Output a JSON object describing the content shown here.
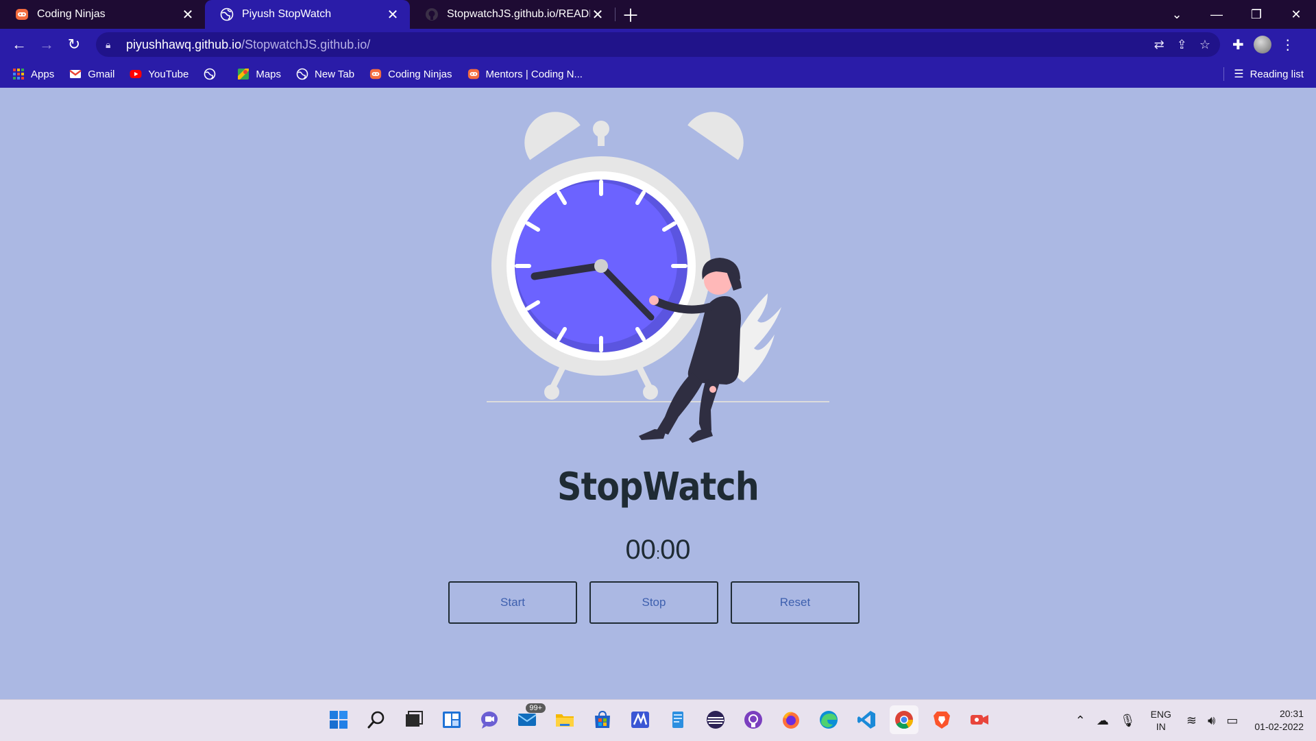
{
  "tabs": [
    {
      "title": "Coding Ninjas",
      "icon": "coding-ninjas-icon",
      "active": false
    },
    {
      "title": "Piyush StopWatch",
      "icon": "globe-icon",
      "active": true
    },
    {
      "title": "StopwatchJS.github.io/README.r",
      "icon": "github-icon",
      "active": false
    }
  ],
  "address": {
    "host": "piyushhawq.github.io",
    "path": "/StopwatchJS.github.io/"
  },
  "bookmarks": [
    {
      "label": "Apps",
      "icon": "apps-grid-icon"
    },
    {
      "label": "Gmail",
      "icon": "gmail-icon"
    },
    {
      "label": "YouTube",
      "icon": "youtube-icon"
    },
    {
      "label": "",
      "icon": "globe-icon"
    },
    {
      "label": "Maps",
      "icon": "maps-icon"
    },
    {
      "label": "New Tab",
      "icon": "globe-icon"
    },
    {
      "label": "Coding Ninjas",
      "icon": "coding-ninjas-icon"
    },
    {
      "label": "Mentors | Coding N...",
      "icon": "coding-ninjas-icon"
    }
  ],
  "reading_list": "Reading list",
  "page": {
    "title": "StopWatch",
    "timer": {
      "minutes": "00",
      "separator": ":",
      "seconds": "00"
    },
    "buttons": {
      "start": "Start",
      "stop": "Stop",
      "reset": "Reset"
    }
  },
  "taskbar": {
    "mail_badge": "99+",
    "language": {
      "line1": "ENG",
      "line2": "IN"
    },
    "time": "20:31",
    "date": "01-02-2022"
  },
  "colors": {
    "page_bg": "#abb8e3",
    "browser_chrome": "#2a1ca8",
    "tabstrip": "#1e0b33",
    "clock_face": "#6c63ff",
    "text_dark": "#1f2b34",
    "button_text": "#3d5fae"
  }
}
